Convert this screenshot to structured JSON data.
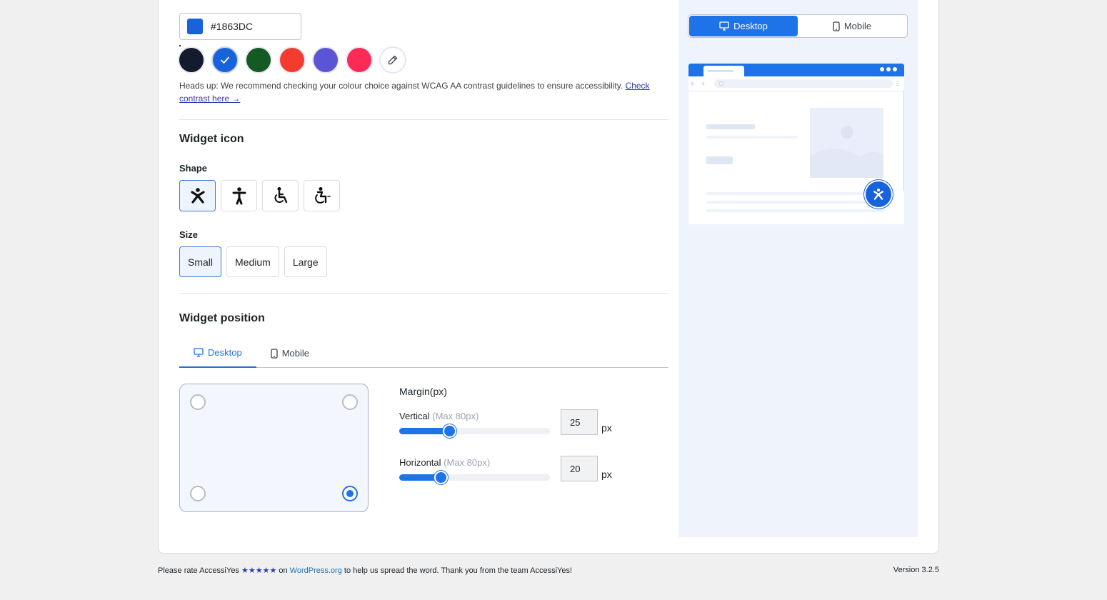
{
  "colors": {
    "primary_hex": "#1863DC",
    "accent": "#1f73e8"
  },
  "color_field": {
    "value": "#1863DC"
  },
  "swatches": [
    {
      "name": "dark-navy",
      "color": "#141b2e",
      "selected": false
    },
    {
      "name": "blue",
      "color": "#1863DC",
      "selected": true
    },
    {
      "name": "green",
      "color": "#145a25",
      "selected": false
    },
    {
      "name": "red",
      "color": "#f43b2f",
      "selected": false
    },
    {
      "name": "purple",
      "color": "#5b55d6",
      "selected": false
    },
    {
      "name": "pink",
      "color": "#fb2b56",
      "selected": false
    },
    {
      "name": "custom-picker",
      "icon": "pencil-icon"
    }
  ],
  "note": {
    "text": "Heads up: We recommend checking your colour choice against WCAG AA contrast guidelines to ensure accessibility. ",
    "link_text": "Check contrast here →"
  },
  "widget_icon": {
    "title": "Widget icon",
    "shape_label": "Shape",
    "shapes": [
      "accessibility-star-icon",
      "person-standing-icon",
      "wheelchair-icon",
      "wheelchair-motion-icon"
    ],
    "size_label": "Size",
    "sizes": [
      "Small",
      "Medium",
      "Large"
    ],
    "selected_size": "Small"
  },
  "widget_position": {
    "title": "Widget position",
    "tabs": [
      "Desktop",
      "Mobile"
    ],
    "active_tab": "Desktop",
    "selected_corner": "bottom-right",
    "margin_title": "Margin(px)",
    "vertical": {
      "label": "Vertical",
      "hint": "(Max 80px)",
      "value": "25",
      "max": 80,
      "unit": "px"
    },
    "horizontal": {
      "label": "Horizontal",
      "hint": "(Max 80px)",
      "value": "20",
      "max": 80,
      "unit": "px"
    }
  },
  "preview": {
    "tabs": [
      "Desktop",
      "Mobile"
    ],
    "active_tab": "Desktop"
  },
  "footer": {
    "rate_prefix": "Please rate AccessiYes ",
    "stars": "★★★★★",
    "on": " on ",
    "link": "WordPress.org",
    "rate_suffix": " to help us spread the word. Thank you from the team AccessiYes!",
    "version": "Version 3.2.5"
  }
}
